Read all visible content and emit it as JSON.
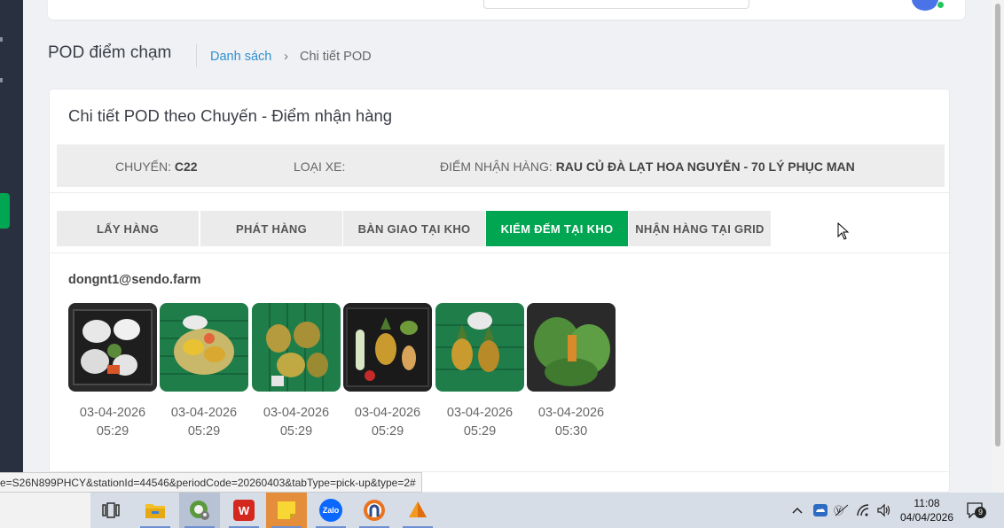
{
  "header": {
    "page_title": "POD điểm chạm",
    "breadcrumb_link": "Danh sách",
    "breadcrumb_separator": "›",
    "breadcrumb_current": "Chi tiết POD"
  },
  "card": {
    "title": "Chi tiết POD theo Chuyến - Điểm nhận hàng",
    "trip_label": "CHUYẾN:",
    "trip_value": "C22",
    "vehicle_label": "LOẠI XE:",
    "vehicle_value": "",
    "pickup_label": "ĐIỂM NHẬN HÀNG:",
    "pickup_value": "RAU CỦ ĐÀ LẠT HOA NGUYỄN - 70 LÝ PHỤC MAN"
  },
  "tabs": [
    {
      "label": "LẤY HÀNG",
      "active": false
    },
    {
      "label": "PHÁT HÀNG",
      "active": false
    },
    {
      "label": "BÀN GIAO TẠI KHO",
      "active": false
    },
    {
      "label": "KIỂM ĐẾM TẠI KHO",
      "active": true
    },
    {
      "label": "NHẬN HÀNG TẠI GRID",
      "active": false
    }
  ],
  "user_email": "dongnt1@sendo.farm",
  "photos": [
    {
      "date": "03-04-2026",
      "time": "05:29"
    },
    {
      "date": "03-04-2026",
      "time": "05:29"
    },
    {
      "date": "03-04-2026",
      "time": "05:29"
    },
    {
      "date": "03-04-2026",
      "time": "05:29"
    },
    {
      "date": "03-04-2026",
      "time": "05:29"
    },
    {
      "date": "03-04-2026",
      "time": "05:30"
    }
  ],
  "status_url": "e=S26N899PHCY&stationId=44546&periodCode=20260403&tabType=pick-up&type=2#",
  "taskbar": {
    "apps": [
      "task-view-icon",
      "file-explorer-icon",
      "browser-icon",
      "wps-icon",
      "sticky-notes-icon",
      "zalo-icon",
      "ultraviewer-icon",
      "app-orange-icon"
    ],
    "zalo_label": "Zalo",
    "wps_label": "W",
    "clock_time": "11:08",
    "clock_date": "04/04/2026",
    "notification_count": "9"
  },
  "colors": {
    "accent": "#00a651",
    "link": "#2f8fd1",
    "sidebar": "#293040"
  }
}
